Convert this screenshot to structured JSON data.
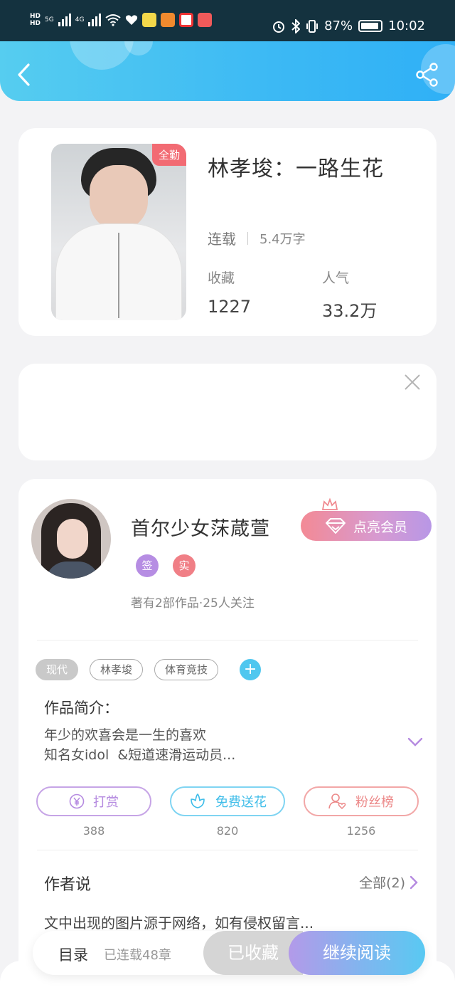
{
  "status_bar": {
    "hd1": "HD",
    "hd2": "HD",
    "net1": "5G",
    "net2": "4G",
    "battery": "87%",
    "time": "10:02"
  },
  "book": {
    "badge": "全勤",
    "title": "林孝埈：一路生花",
    "status": "连载",
    "words": "5.4万字",
    "collect_label": "收藏",
    "collect_value": "1227",
    "popularity_label": "人气",
    "popularity_value": "33.2万"
  },
  "author": {
    "name": "首尔少女莯葴萱",
    "tag_sign": "签",
    "tag_real": "实",
    "meta": "著有2部作品·25人关注",
    "vip_button": "点亮会员"
  },
  "tags": [
    "现代",
    "林孝埈",
    "体育竞技"
  ],
  "intro": {
    "title": "作品简介：",
    "line1": "年少的欢喜会是一生的喜欢",
    "line2": "知名女idol  &短道速滑运动员..."
  },
  "actions": {
    "reward_label": "打赏",
    "reward_count": "388",
    "flower_label": "免费送花",
    "flower_count": "820",
    "fans_label": "粉丝榜",
    "fans_count": "1256"
  },
  "author_says": {
    "title": "作者说",
    "all_link": "全部(2)",
    "text": "文中出现的图片源于网络，如有侵权留言..."
  },
  "bottom_bar": {
    "toc": "目录",
    "chapters": "已连载48章",
    "collected": "已收藏",
    "continue": "继续阅读"
  },
  "colors": {
    "header": "#3cb9f4",
    "reward": "#b58ae0",
    "flower": "#4fc7ef",
    "fans": "#ef8f8f",
    "badge": "#f26b73"
  }
}
